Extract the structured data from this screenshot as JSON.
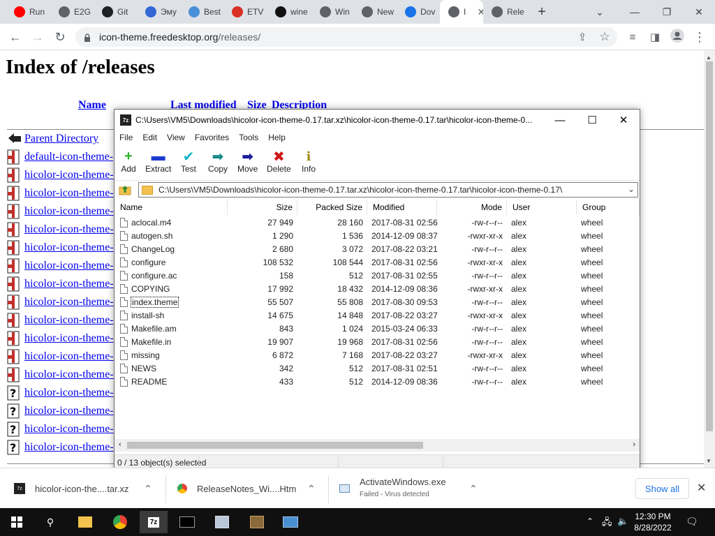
{
  "tabs": [
    {
      "label": "Run",
      "color": "#ff0000"
    },
    {
      "label": "E2G",
      "color": "#5f6368"
    },
    {
      "label": "Git",
      "color": "#202124"
    },
    {
      "label": "Эму",
      "color": "#3367d6"
    },
    {
      "label": "Best",
      "color": "#4a90d9"
    },
    {
      "label": "ETV",
      "color": "#d93025"
    },
    {
      "label": "wine",
      "color": "#111111"
    },
    {
      "label": "Win",
      "color": "#5f6368"
    },
    {
      "label": "New",
      "color": "#5f6368"
    },
    {
      "label": "Dov",
      "color": "#1a73e8"
    },
    {
      "label": "I",
      "color": "#5f6368"
    },
    {
      "label": "Rele",
      "color": "#5f6368"
    }
  ],
  "address": {
    "host": "icon-theme.freedesktop.org",
    "path": "/releases/"
  },
  "page": {
    "title": "Index of /releases",
    "columns": {
      "name": "Name",
      "last_modified": "Last modified",
      "size": "Size",
      "description": "Description"
    },
    "parent": "Parent Directory",
    "entries": [
      {
        "label": "default-icon-theme-",
        "icon": "archive"
      },
      {
        "label": "hicolor-icon-theme-",
        "icon": "archive"
      },
      {
        "label": "hicolor-icon-theme-",
        "icon": "archive"
      },
      {
        "label": "hicolor-icon-theme-",
        "icon": "archive"
      },
      {
        "label": "hicolor-icon-theme-",
        "icon": "archive"
      },
      {
        "label": "hicolor-icon-theme-",
        "icon": "archive"
      },
      {
        "label": "hicolor-icon-theme-",
        "icon": "archive"
      },
      {
        "label": "hicolor-icon-theme-",
        "icon": "archive"
      },
      {
        "label": "hicolor-icon-theme-",
        "icon": "archive"
      },
      {
        "label": "hicolor-icon-theme-",
        "icon": "archive"
      },
      {
        "label": "hicolor-icon-theme-",
        "icon": "archive"
      },
      {
        "label": "hicolor-icon-theme-",
        "icon": "archive"
      },
      {
        "label": "hicolor-icon-theme-",
        "icon": "archive"
      },
      {
        "label": "hicolor-icon-theme-",
        "icon": "unknown"
      },
      {
        "label": "hicolor-icon-theme-",
        "icon": "unknown"
      },
      {
        "label": "hicolor-icon-theme-",
        "icon": "unknown"
      },
      {
        "label": "hicolor-icon-theme-",
        "icon": "unknown"
      }
    ]
  },
  "zip": {
    "app_icon": "7z",
    "title": "C:\\Users\\VM5\\Downloads\\hicolor-icon-theme-0.17.tar.xz\\hicolor-icon-theme-0.17.tar\\hicolor-icon-theme-0...",
    "menu": [
      "File",
      "Edit",
      "View",
      "Favorites",
      "Tools",
      "Help"
    ],
    "tools": [
      {
        "label": "Add",
        "icon": "plus-icon",
        "glyph": "+",
        "color": "#2db52d"
      },
      {
        "label": "Extract",
        "icon": "minus-icon",
        "glyph": "▬",
        "color": "#1c3bd0"
      },
      {
        "label": "Test",
        "icon": "check-icon",
        "glyph": "✔",
        "color": "#17b6c9"
      },
      {
        "label": "Copy",
        "icon": "copy-arrow-icon",
        "glyph": "➡",
        "color": "#1a8a8a"
      },
      {
        "label": "Move",
        "icon": "move-arrow-icon",
        "glyph": "➡",
        "color": "#1c1c9a"
      },
      {
        "label": "Delete",
        "icon": "delete-x-icon",
        "glyph": "✖",
        "color": "#d01818"
      },
      {
        "label": "Info",
        "icon": "info-icon",
        "glyph": "i",
        "color": "#a08a10"
      }
    ],
    "path": "C:\\Users\\VM5\\Downloads\\hicolor-icon-theme-0.17.tar.xz\\hicolor-icon-theme-0.17.tar\\hicolor-icon-theme-0.17\\",
    "headers": [
      "Name",
      "Size",
      "Packed Size",
      "Modified",
      "Mode",
      "User",
      "Group"
    ],
    "files": [
      [
        "aclocal.m4",
        "27 949",
        "28 160",
        "2017-08-31 02:56",
        "-rw-r--r--",
        "alex",
        "wheel"
      ],
      [
        "autogen.sh",
        "1 290",
        "1 536",
        "2014-12-09 08:37",
        "-rwxr-xr-x",
        "alex",
        "wheel"
      ],
      [
        "ChangeLog",
        "2 680",
        "3 072",
        "2017-08-22 03:21",
        "-rw-r--r--",
        "alex",
        "wheel"
      ],
      [
        "configure",
        "108 532",
        "108 544",
        "2017-08-31 02:56",
        "-rwxr-xr-x",
        "alex",
        "wheel"
      ],
      [
        "configure.ac",
        "158",
        "512",
        "2017-08-31 02:55",
        "-rw-r--r--",
        "alex",
        "wheel"
      ],
      [
        "COPYING",
        "17 992",
        "18 432",
        "2014-12-09 08:36",
        "-rwxr-xr-x",
        "alex",
        "wheel"
      ],
      [
        "index.theme",
        "55 507",
        "55 808",
        "2017-08-30 09:53",
        "-rw-r--r--",
        "alex",
        "wheel"
      ],
      [
        "install-sh",
        "14 675",
        "14 848",
        "2017-08-22 03:27",
        "-rwxr-xr-x",
        "alex",
        "wheel"
      ],
      [
        "Makefile.am",
        "843",
        "1 024",
        "2015-03-24 06:33",
        "-rw-r--r--",
        "alex",
        "wheel"
      ],
      [
        "Makefile.in",
        "19 907",
        "19 968",
        "2017-08-31 02:56",
        "-rw-r--r--",
        "alex",
        "wheel"
      ],
      [
        "missing",
        "6 872",
        "7 168",
        "2017-08-22 03:27",
        "-rwxr-xr-x",
        "alex",
        "wheel"
      ],
      [
        "NEWS",
        "342",
        "512",
        "2017-08-31 02:51",
        "-rw-r--r--",
        "alex",
        "wheel"
      ],
      [
        "README",
        "433",
        "512",
        "2014-12-09 08:36",
        "-rw-r--r--",
        "alex",
        "wheel"
      ]
    ],
    "selected_file": "index.theme",
    "status": "0 / 13 object(s) selected"
  },
  "downloads": {
    "items": [
      {
        "name": "hicolor-icon-the....tar.xz",
        "sub": ""
      },
      {
        "name": "ReleaseNotes_Wi....Htm",
        "sub": ""
      },
      {
        "name": "ActivateWindows.exe",
        "sub": "Failed - Virus detected"
      }
    ],
    "show_all": "Show all"
  },
  "taskbar": {
    "tray_icon": "7z",
    "time": "12:30 PM",
    "date": "8/28/2022"
  }
}
